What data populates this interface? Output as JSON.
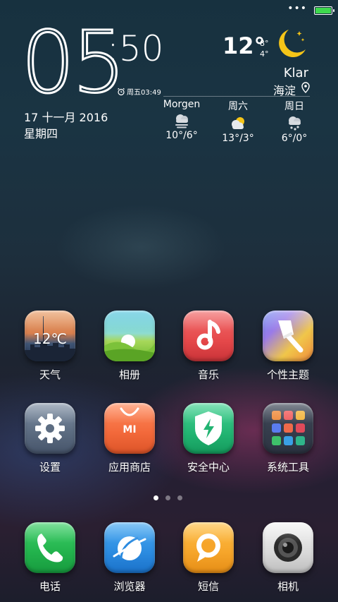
{
  "status": {
    "more_icon": "more-dots-icon",
    "battery_level": 1.0,
    "battery_color": "#3ed94e"
  },
  "clock": {
    "hour": "05",
    "minute": ":50",
    "alarm": "周五03:49",
    "date": "17 十一月 2016",
    "weekday": "星期四"
  },
  "weather": {
    "current_temp": "12°",
    "high": "8°",
    "low": "4°",
    "condition": "Klar",
    "city": "海淀",
    "forecast": [
      {
        "day": "Morgen",
        "icon": "cloudy-fog-icon",
        "temps": "10°/6°"
      },
      {
        "day": "周六",
        "icon": "partly-sunny-icon",
        "temps": "13°/3°"
      },
      {
        "day": "周日",
        "icon": "rain-icon",
        "temps": "6°/0°"
      }
    ]
  },
  "apps": {
    "row1": [
      {
        "label": "天气",
        "icon_text": "12℃"
      },
      {
        "label": "相册"
      },
      {
        "label": "音乐"
      },
      {
        "label": "个性主题"
      }
    ],
    "row2": [
      {
        "label": "设置"
      },
      {
        "label": "应用商店",
        "icon_text": "MI"
      },
      {
        "label": "安全中心"
      },
      {
        "label": "系统工具"
      }
    ]
  },
  "pager": {
    "pages": 3,
    "active": 1
  },
  "dock": [
    {
      "label": "电话"
    },
    {
      "label": "浏览器"
    },
    {
      "label": "短信"
    },
    {
      "label": "相机"
    }
  ]
}
